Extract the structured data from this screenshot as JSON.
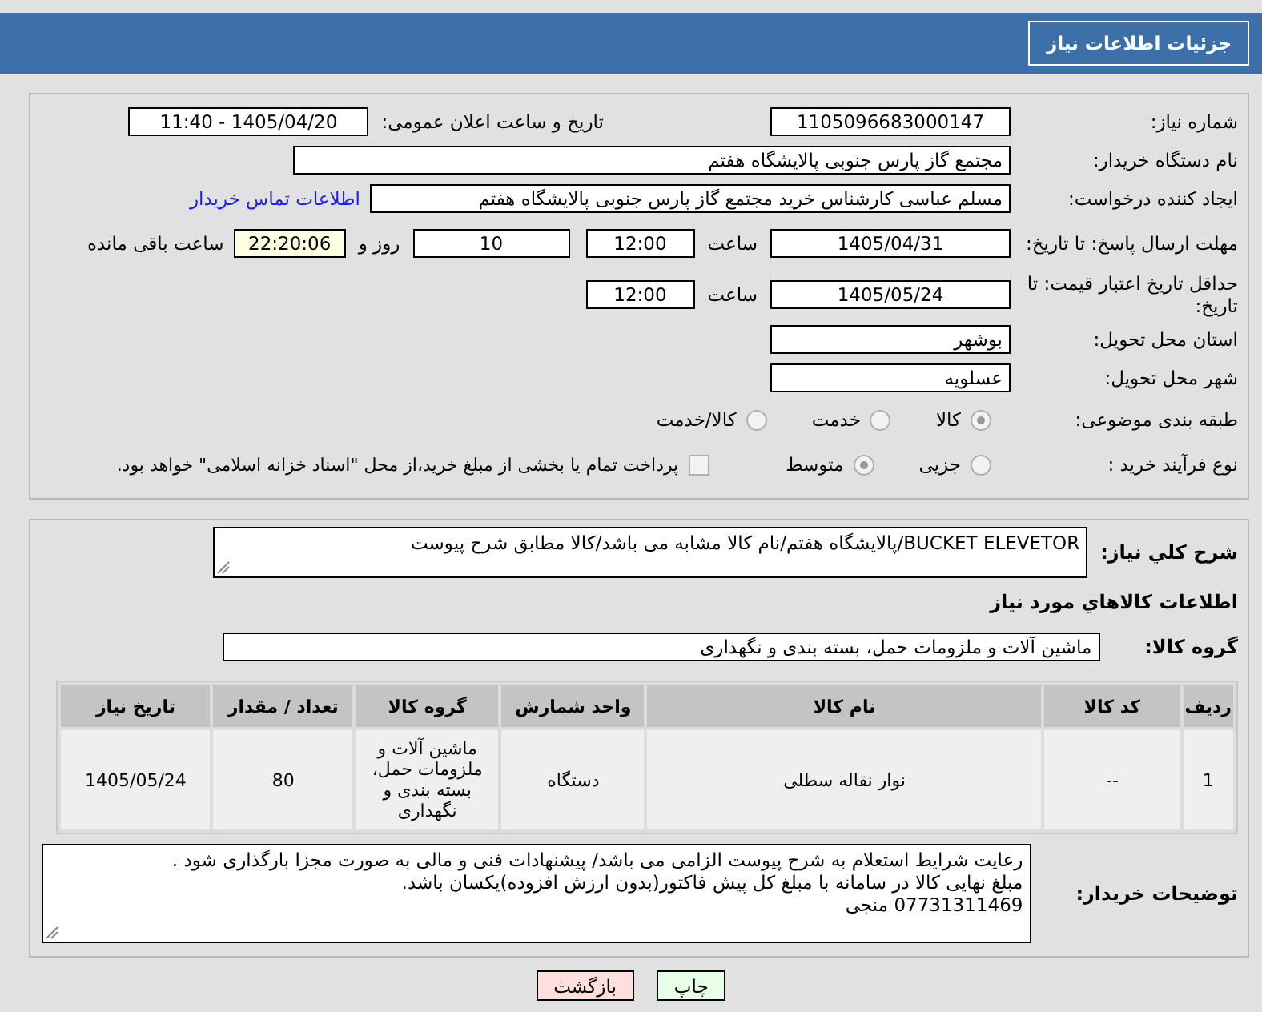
{
  "title": "جزئیات اطلاعات نیاز",
  "need_number": {
    "label": "شماره نیاز:",
    "value": "1105096683000147"
  },
  "announce": {
    "label": "تاریخ و ساعت اعلان عمومی:",
    "value": "1405/04/20 - 11:40"
  },
  "buyer_org": {
    "label": "نام دستگاه خریدار:",
    "value": "مجتمع گاز پارس جنوبی  پالایشگاه هفتم"
  },
  "requester": {
    "label": "ایجاد کننده درخواست:",
    "value": "مسلم عباسی کارشناس خرید مجتمع گاز پارس جنوبی  پالایشگاه هفتم",
    "link": "اطلاعات تماس خریدار"
  },
  "reply_deadline": {
    "label": "مهلت ارسال پاسخ: تا تاریخ:",
    "date": "1405/04/31",
    "time_label": "ساعت",
    "time": "12:00",
    "days": "10",
    "days_label": "روز و",
    "remaining": "22:20:06",
    "remaining_label": "ساعت باقی مانده"
  },
  "price_validity": {
    "label": "حداقل تاریخ اعتبار قیمت: تا تاریخ:",
    "date": "1405/05/24",
    "time_label": "ساعت",
    "time": "12:00"
  },
  "province": {
    "label": "استان محل تحویل:",
    "value": "بوشهر"
  },
  "city": {
    "label": "شهر محل تحویل:",
    "value": "عسلویه"
  },
  "category": {
    "label": "طبقه بندی موضوعی:",
    "options": [
      {
        "label": "کالا",
        "selected": true
      },
      {
        "label": "خدمت",
        "selected": false
      },
      {
        "label": "کالا/خدمت",
        "selected": false
      }
    ]
  },
  "process": {
    "label": "نوع فرآیند خرید :",
    "options": [
      {
        "label": "جزیی",
        "selected": false
      },
      {
        "label": "متوسط",
        "selected": true
      }
    ],
    "payment": {
      "label": "پرداخت تمام یا بخشی از مبلغ خرید،از محل \"اسناد خزانه اسلامی\" خواهد بود.",
      "checked": false
    }
  },
  "description": {
    "label": "شرح کلي نياز:",
    "value": "BUCKET ELEVETOR/پالایشگاه هفتم/نام کالا مشابه می باشد/کالا مطابق شرح پیوست"
  },
  "goods_heading": "اطلاعات کالاهاي مورد نياز",
  "goods_group": {
    "label": "گروه کالا:",
    "value": "ماشین آلات و ملزومات حمل، بسته بندی و نگهداری"
  },
  "table": {
    "columns": [
      "ردیف",
      "کد کالا",
      "نام کالا",
      "واحد شمارش",
      "گروه کالا",
      "تعداد / مقدار",
      "تاریخ نیاز"
    ],
    "rows": [
      [
        "1",
        "--",
        "نوار نقاله سطلی",
        "دستگاه",
        "ماشین آلات و ملزومات حمل، بسته بندی و نگهداری",
        "80",
        "1405/05/24"
      ]
    ]
  },
  "buyer_notes": {
    "label": "توضیحات خریدار:",
    "lines": [
      "رعایت شرایط استعلام به شرح پیوست الزامی می باشد/ پیشنهادات فنی و مالی به صورت مجزا بارگذاری شود .",
      "مبلغ نهایی کالا در سامانه با مبلغ کل پیش فاکتور(بدون ارزش افزوده)یکسان باشد.",
      "07731311469 منجی"
    ]
  },
  "buttons": [
    {
      "kind": "print",
      "label": "چاپ"
    },
    {
      "kind": "back",
      "label": "بازگشت"
    }
  ]
}
